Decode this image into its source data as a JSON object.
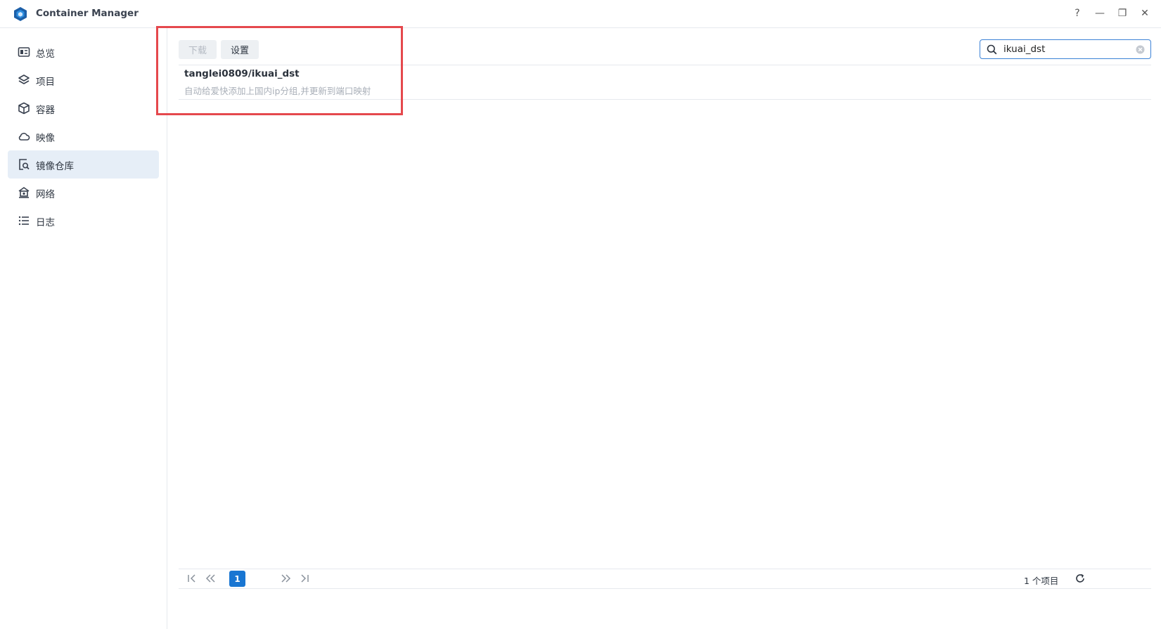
{
  "app": {
    "title": "Container Manager",
    "accent": "#1976d2"
  },
  "window_controls": [
    {
      "name": "help",
      "glyph": "?"
    },
    {
      "name": "minimize",
      "glyph": "—"
    },
    {
      "name": "restore",
      "glyph": "❐"
    },
    {
      "name": "close",
      "glyph": "✕"
    }
  ],
  "sidebar": {
    "items": [
      {
        "label": "总览",
        "icon": "overview-icon"
      },
      {
        "label": "项目",
        "icon": "layers-icon"
      },
      {
        "label": "容器",
        "icon": "box-icon"
      },
      {
        "label": "映像",
        "icon": "cloud-icon"
      },
      {
        "label": "镜像仓库",
        "icon": "registry-search-icon",
        "active": true
      },
      {
        "label": "网络",
        "icon": "network-icon"
      },
      {
        "label": "日志",
        "icon": "list-icon"
      }
    ]
  },
  "toolbar": {
    "download_label": "下载",
    "settings_label": "设置"
  },
  "search": {
    "value": "ikuai_dst",
    "placeholder": ""
  },
  "results": [
    {
      "name": "tanglei0809/ikuai_dst",
      "description": "自动给爱快添加上国内ip分组,并更新到端口映射"
    }
  ],
  "pagination": {
    "current_page": "1",
    "item_count": "1 个项目"
  },
  "highlight_color": "#e5484d"
}
